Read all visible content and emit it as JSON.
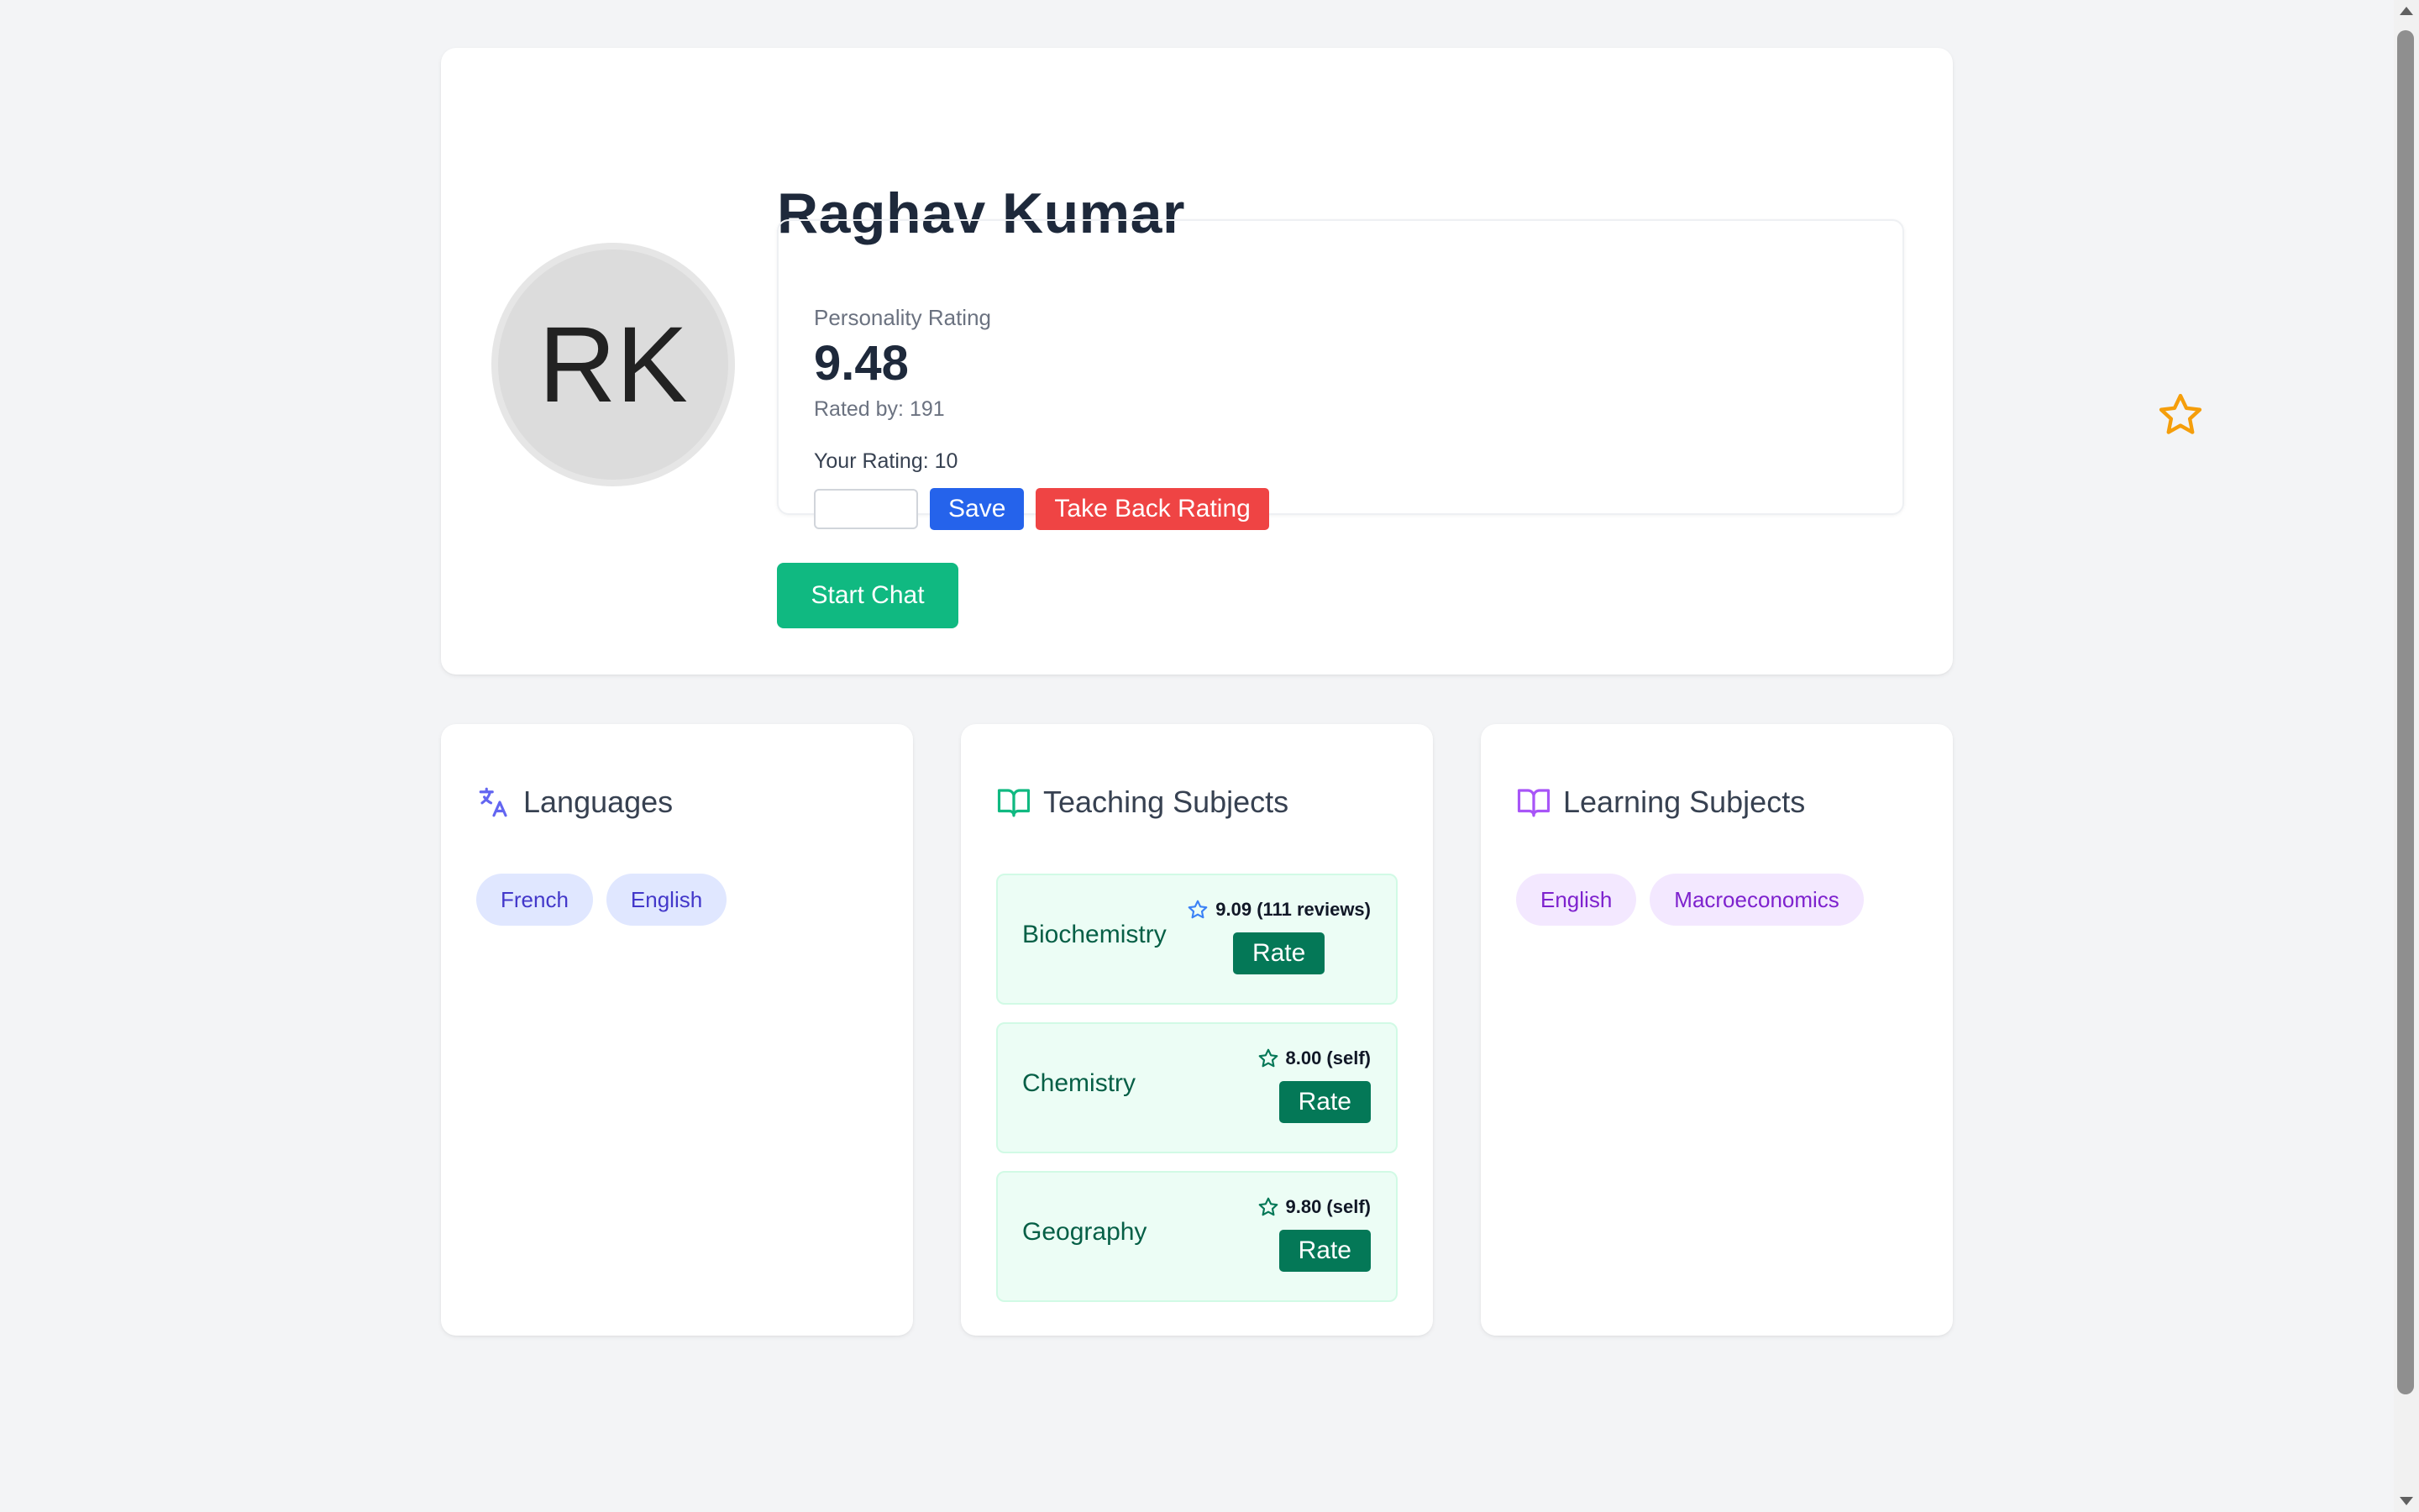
{
  "profile": {
    "initials": "RK",
    "name": "Raghav Kumar",
    "personality_label": "Personality Rating",
    "personality_value": "9.48",
    "rated_by": "Rated by: 191",
    "your_rating": "Your Rating: 10",
    "save_label": "Save",
    "take_back_label": "Take Back Rating",
    "start_chat_label": "Start Chat"
  },
  "languages": {
    "title": "Languages",
    "items": [
      "French",
      "English"
    ]
  },
  "teaching": {
    "title": "Teaching Subjects",
    "subjects": [
      {
        "name": "Biochemistry",
        "score": "9.09 (111 reviews)",
        "rate_label": "Rate"
      },
      {
        "name": "Chemistry",
        "score": "8.00 (self)",
        "rate_label": "Rate"
      },
      {
        "name": "Geography",
        "score": "9.80 (self)",
        "rate_label": "Rate"
      }
    ]
  },
  "learning": {
    "title": "Learning Subjects",
    "items": [
      "English",
      "Macroeconomics"
    ]
  },
  "colors": {
    "favorite_star": "#f59e0b",
    "save": "#2563eb",
    "take_back": "#ef4444",
    "start_chat": "#10b981",
    "rate": "#047857"
  }
}
